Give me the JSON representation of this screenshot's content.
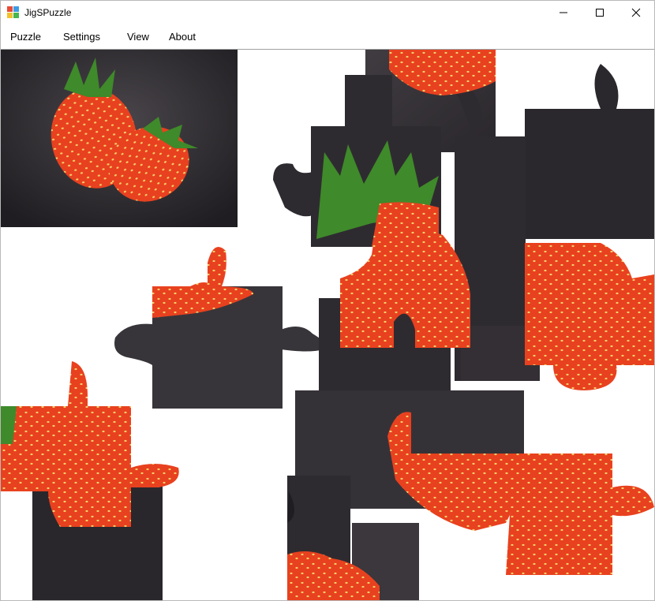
{
  "window": {
    "title": "JigSPuzzle",
    "controls": [
      "minimize-icon",
      "maximize-icon",
      "close-icon"
    ]
  },
  "menu": {
    "items": [
      "Puzzle",
      "Settings",
      "View",
      "About"
    ]
  },
  "puzzle": {
    "image_subject": "two red strawberries on dark background",
    "colors": {
      "background": "#ffffff",
      "dark": "#2e2b30",
      "dark_mid": "#3d393e",
      "red": "#e8411f",
      "red_light": "#f0572a",
      "seed": "#f5d06a",
      "leaf": "#3f8a2a"
    }
  }
}
